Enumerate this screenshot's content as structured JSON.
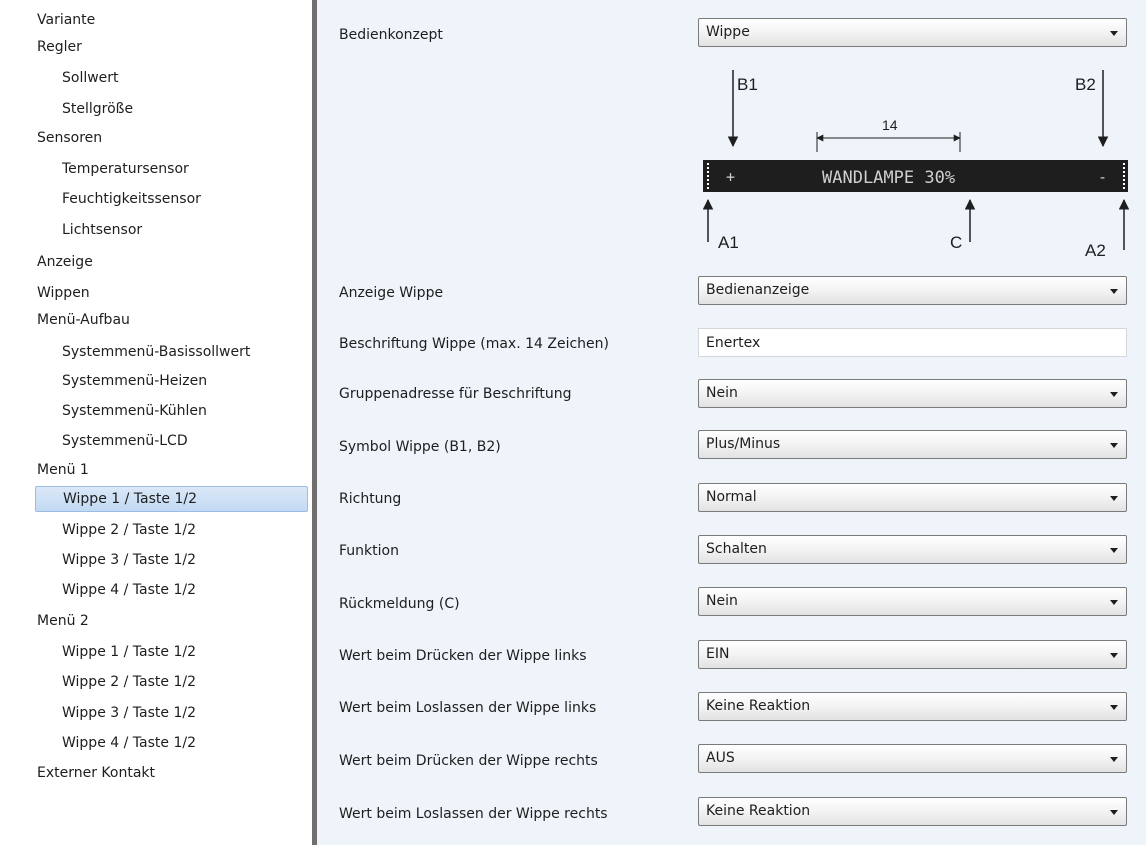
{
  "sidebar": {
    "items": [
      {
        "label": "Variante"
      },
      {
        "label": "Regler"
      },
      {
        "label": "Sollwert"
      },
      {
        "label": "Stellgröße"
      },
      {
        "label": "Sensoren"
      },
      {
        "label": "Temperatursensor"
      },
      {
        "label": "Feuchtigkeitssensor"
      },
      {
        "label": "Lichtsensor"
      },
      {
        "label": "Anzeige"
      },
      {
        "label": "Wippen"
      },
      {
        "label": "Menü-Aufbau"
      },
      {
        "label": "Systemmenü-Basissollwert"
      },
      {
        "label": "Systemmenü-Heizen"
      },
      {
        "label": "Systemmenü-Kühlen"
      },
      {
        "label": "Systemmenü-LCD"
      },
      {
        "label": "Menü 1"
      },
      {
        "label": "Wippe 1 / Taste 1/2",
        "selected": true
      },
      {
        "label": "Wippe 2 / Taste 1/2"
      },
      {
        "label": "Wippe 3 / Taste 1/2"
      },
      {
        "label": "Wippe 4 / Taste 1/2"
      },
      {
        "label": "Menü 2"
      },
      {
        "label": "Wippe 1 / Taste 1/2"
      },
      {
        "label": "Wippe 2 / Taste 1/2"
      },
      {
        "label": "Wippe 3 / Taste 1/2"
      },
      {
        "label": "Wippe 4 / Taste 1/2"
      },
      {
        "label": "Externer Kontakt"
      }
    ]
  },
  "params": [
    {
      "label": "Bedienkonzept",
      "value": "Wippe"
    },
    {
      "label": "Anzeige Wippe",
      "value": "Bedienanzeige"
    },
    {
      "label": "Beschriftung Wippe (max. 14 Zeichen)",
      "value": "Enertex"
    },
    {
      "label": "Gruppenadresse für Beschriftung",
      "value": "Nein"
    },
    {
      "label": "Symbol Wippe (B1, B2)",
      "value": "Plus/Minus"
    },
    {
      "label": "Richtung",
      "value": "Normal"
    },
    {
      "label": "Funktion",
      "value": "Schalten"
    },
    {
      "label": "Rückmeldung (C)",
      "value": "Nein"
    },
    {
      "label": "Wert beim Drücken der Wippe links",
      "value": "EIN"
    },
    {
      "label": "Wert beim Loslassen der Wippe links",
      "value": "Keine Reaktion"
    },
    {
      "label": "Wert beim Drücken der Wippe rechts",
      "value": "AUS"
    },
    {
      "label": "Wert beim Loslassen der Wippe rechts",
      "value": "Keine Reaktion"
    }
  ],
  "diagram": {
    "b1": "B1",
    "b2": "B2",
    "a1": "A1",
    "a2": "A2",
    "c": "C",
    "width_label": "14",
    "display_text": "WANDLAMPE 30%",
    "plus": "+",
    "minus": "-"
  },
  "colors": {
    "panel_bg": "#eef4f9",
    "selection_bg": "#c9ddf5",
    "selection_border": "#9cbde3",
    "splitter": "#6f6f6f",
    "display_bg": "#1e1e1e",
    "display_text": "#d0d0d0"
  }
}
